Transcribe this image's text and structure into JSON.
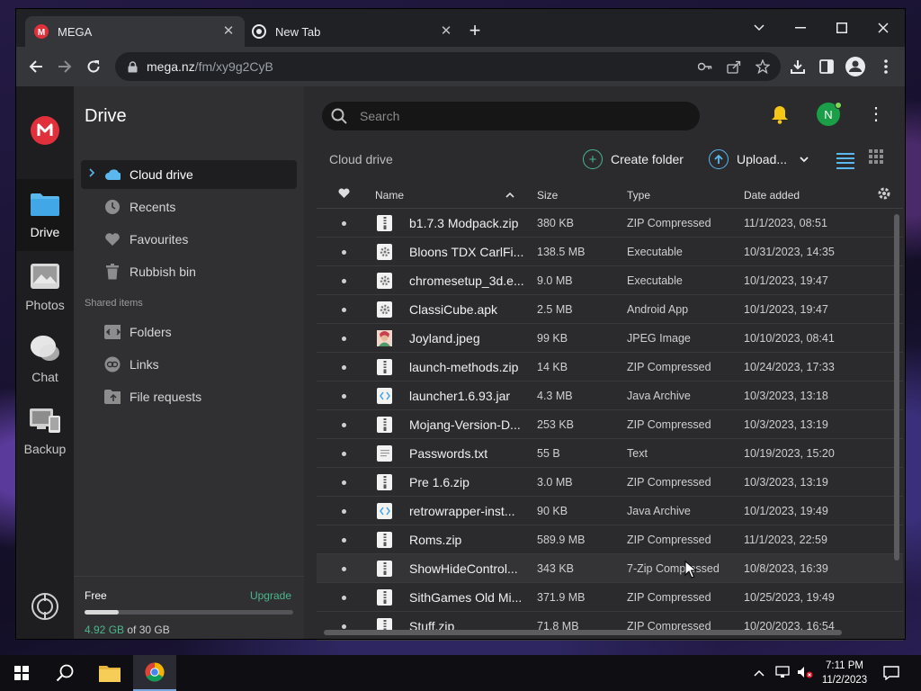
{
  "browser": {
    "tabs": [
      {
        "title": "MEGA",
        "icon": "mega-logo-icon",
        "active": true
      },
      {
        "title": "New Tab",
        "icon": "chrome-icon",
        "active": false
      }
    ],
    "url_host": "mega.nz",
    "url_path": "/fm/xy9g2CyB"
  },
  "rail": {
    "items": [
      {
        "label": "Drive",
        "icon": "folder-icon",
        "active": true
      },
      {
        "label": "Photos",
        "icon": "photos-icon"
      },
      {
        "label": "Chat",
        "icon": "chat-icon"
      },
      {
        "label": "Backup",
        "icon": "backup-icon"
      }
    ]
  },
  "sidenav": {
    "title": "Drive",
    "items": [
      {
        "label": "Cloud drive",
        "icon": "cloud-icon"
      },
      {
        "label": "Recents",
        "icon": "clock-icon"
      },
      {
        "label": "Favourites",
        "icon": "heart-icon"
      },
      {
        "label": "Rubbish bin",
        "icon": "trash-icon"
      }
    ],
    "shared_heading": "Shared items",
    "shared_items": [
      {
        "label": "Folders",
        "icon": "shared-folder-icon"
      },
      {
        "label": "Links",
        "icon": "link-icon"
      },
      {
        "label": "File requests",
        "icon": "file-request-icon"
      }
    ],
    "storage": {
      "plan": "Free",
      "upgrade": "Upgrade",
      "used": "4.92 GB",
      "of_total": " of 30 GB",
      "used_fraction": 0.164
    }
  },
  "main": {
    "search_placeholder": "Search",
    "avatar_initial": "N",
    "breadcrumb": "Cloud drive",
    "create_folder": "Create folder",
    "upload": "Upload...",
    "columns": {
      "name": "Name",
      "size": "Size",
      "type": "Type",
      "date": "Date added"
    },
    "files": [
      {
        "name": "b1.7.3 Modpack.zip",
        "size": "380 KB",
        "type": "ZIP Compressed",
        "date": "11/1/2023, 08:51",
        "kind": "zip"
      },
      {
        "name": "Bloons TDX CarlFi...",
        "size": "138.5 MB",
        "type": "Executable",
        "date": "10/31/2023, 14:35",
        "kind": "exe"
      },
      {
        "name": "chromesetup_3d.e...",
        "size": "9.0 MB",
        "type": "Executable",
        "date": "10/1/2023, 19:47",
        "kind": "exe"
      },
      {
        "name": "ClassiCube.apk",
        "size": "2.5 MB",
        "type": "Android App",
        "date": "10/1/2023, 19:47",
        "kind": "exe"
      },
      {
        "name": "Joyland.jpeg",
        "size": "99 KB",
        "type": "JPEG Image",
        "date": "10/10/2023, 08:41",
        "kind": "image"
      },
      {
        "name": "launch-methods.zip",
        "size": "14 KB",
        "type": "ZIP Compressed",
        "date": "10/24/2023, 17:33",
        "kind": "zip"
      },
      {
        "name": "launcher1.6.93.jar",
        "size": "4.3 MB",
        "type": "Java Archive",
        "date": "10/3/2023, 13:18",
        "kind": "code"
      },
      {
        "name": "Mojang-Version-D...",
        "size": "253 KB",
        "type": "ZIP Compressed",
        "date": "10/3/2023, 13:19",
        "kind": "zip"
      },
      {
        "name": "Passwords.txt",
        "size": "55 B",
        "type": "Text",
        "date": "10/19/2023, 15:20",
        "kind": "text"
      },
      {
        "name": "Pre 1.6.zip",
        "size": "3.0 MB",
        "type": "ZIP Compressed",
        "date": "10/3/2023, 13:19",
        "kind": "zip"
      },
      {
        "name": "retrowrapper-inst...",
        "size": "90 KB",
        "type": "Java Archive",
        "date": "10/1/2023, 19:49",
        "kind": "code"
      },
      {
        "name": "Roms.zip",
        "size": "589.9 MB",
        "type": "ZIP Compressed",
        "date": "11/1/2023, 22:59",
        "kind": "zip"
      },
      {
        "name": "ShowHideControl...",
        "size": "343 KB",
        "type": "7-Zip Compressed",
        "date": "10/8/2023, 16:39",
        "kind": "zip"
      },
      {
        "name": "SithGames Old Mi...",
        "size": "371.9 MB",
        "type": "ZIP Compressed",
        "date": "10/25/2023, 19:49",
        "kind": "zip"
      },
      {
        "name": "Stuff.zip",
        "size": "71.8 MB",
        "type": "ZIP Compressed",
        "date": "10/20/2023, 16:54",
        "kind": "zip"
      }
    ]
  },
  "taskbar": {
    "time": "7:11 PM",
    "date": "11/2/2023"
  },
  "colors": {
    "mega_red": "#e0303b",
    "accent_green": "#4ab78c",
    "cloud_blue": "#5ab8ef"
  }
}
